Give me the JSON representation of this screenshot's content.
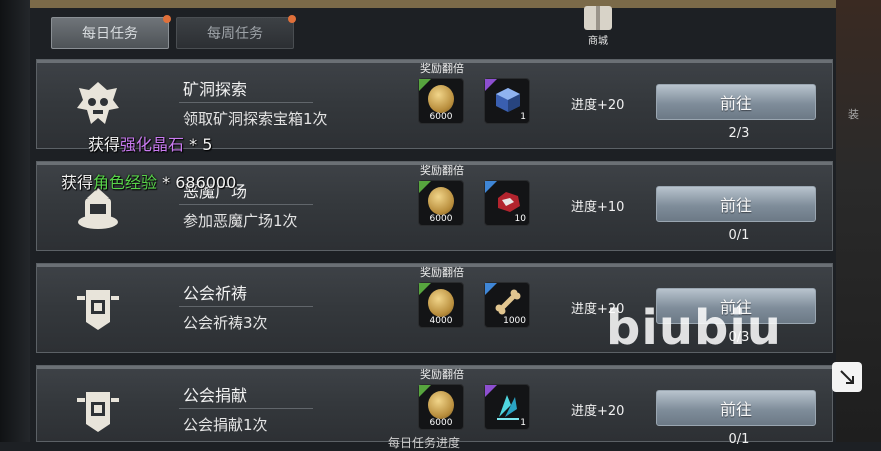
{
  "tabs": [
    {
      "label": "每日任务",
      "active": true
    },
    {
      "label": "每周任务",
      "active": false
    }
  ],
  "shop": {
    "label": "商城"
  },
  "tasks": [
    {
      "title": "矿洞探索",
      "desc": "领取矿洞探索宝箱1次",
      "reward_label": "奖励翻倍",
      "rewards": [
        {
          "icon": "gold-coin-icon",
          "count": "6000",
          "rarity": "green"
        },
        {
          "icon": "crystal-cube-icon",
          "count": "1",
          "rarity": "purple"
        }
      ],
      "progress_add": "进度+20",
      "button": "前往",
      "progress": "2/3"
    },
    {
      "title": "恶魔广场",
      "desc": "参加恶魔广场1次",
      "reward_label": "奖励翻倍",
      "rewards": [
        {
          "icon": "gold-coin-icon",
          "count": "6000",
          "rarity": "green"
        },
        {
          "icon": "red-gem-icon",
          "count": "10",
          "rarity": "blue"
        }
      ],
      "progress_add": "进度+10",
      "button": "前往",
      "progress": "0/1"
    },
    {
      "title": "公会祈祷",
      "desc": "公会祈祷3次",
      "reward_label": "奖励翻倍",
      "rewards": [
        {
          "icon": "gold-coin-icon",
          "count": "4000",
          "rarity": "green"
        },
        {
          "icon": "bone-icon",
          "count": "1000",
          "rarity": "blue"
        }
      ],
      "progress_add": "进度+20",
      "button": "前往",
      "progress": "0/3"
    },
    {
      "title": "公会捐献",
      "desc": "公会捐献1次",
      "reward_label": "奖励翻倍",
      "rewards": [
        {
          "icon": "gold-coin-icon",
          "count": "6000",
          "rarity": "green"
        },
        {
          "icon": "cyan-crystal-icon",
          "count": "1",
          "rarity": "purple"
        }
      ],
      "progress_add": "进度+20",
      "button": "前往",
      "progress": "0/1"
    }
  ],
  "toasts": [
    {
      "prefix": "获得",
      "item": "强化晶石",
      "suffix": " * 5",
      "color": "#c97bf0"
    },
    {
      "prefix": "获得",
      "item": "角色经验",
      "suffix": " * 686000",
      "color": "#58d34a"
    }
  ],
  "footer_text": "每日任务进度",
  "watermark": "biubiu",
  "side_label": "装"
}
